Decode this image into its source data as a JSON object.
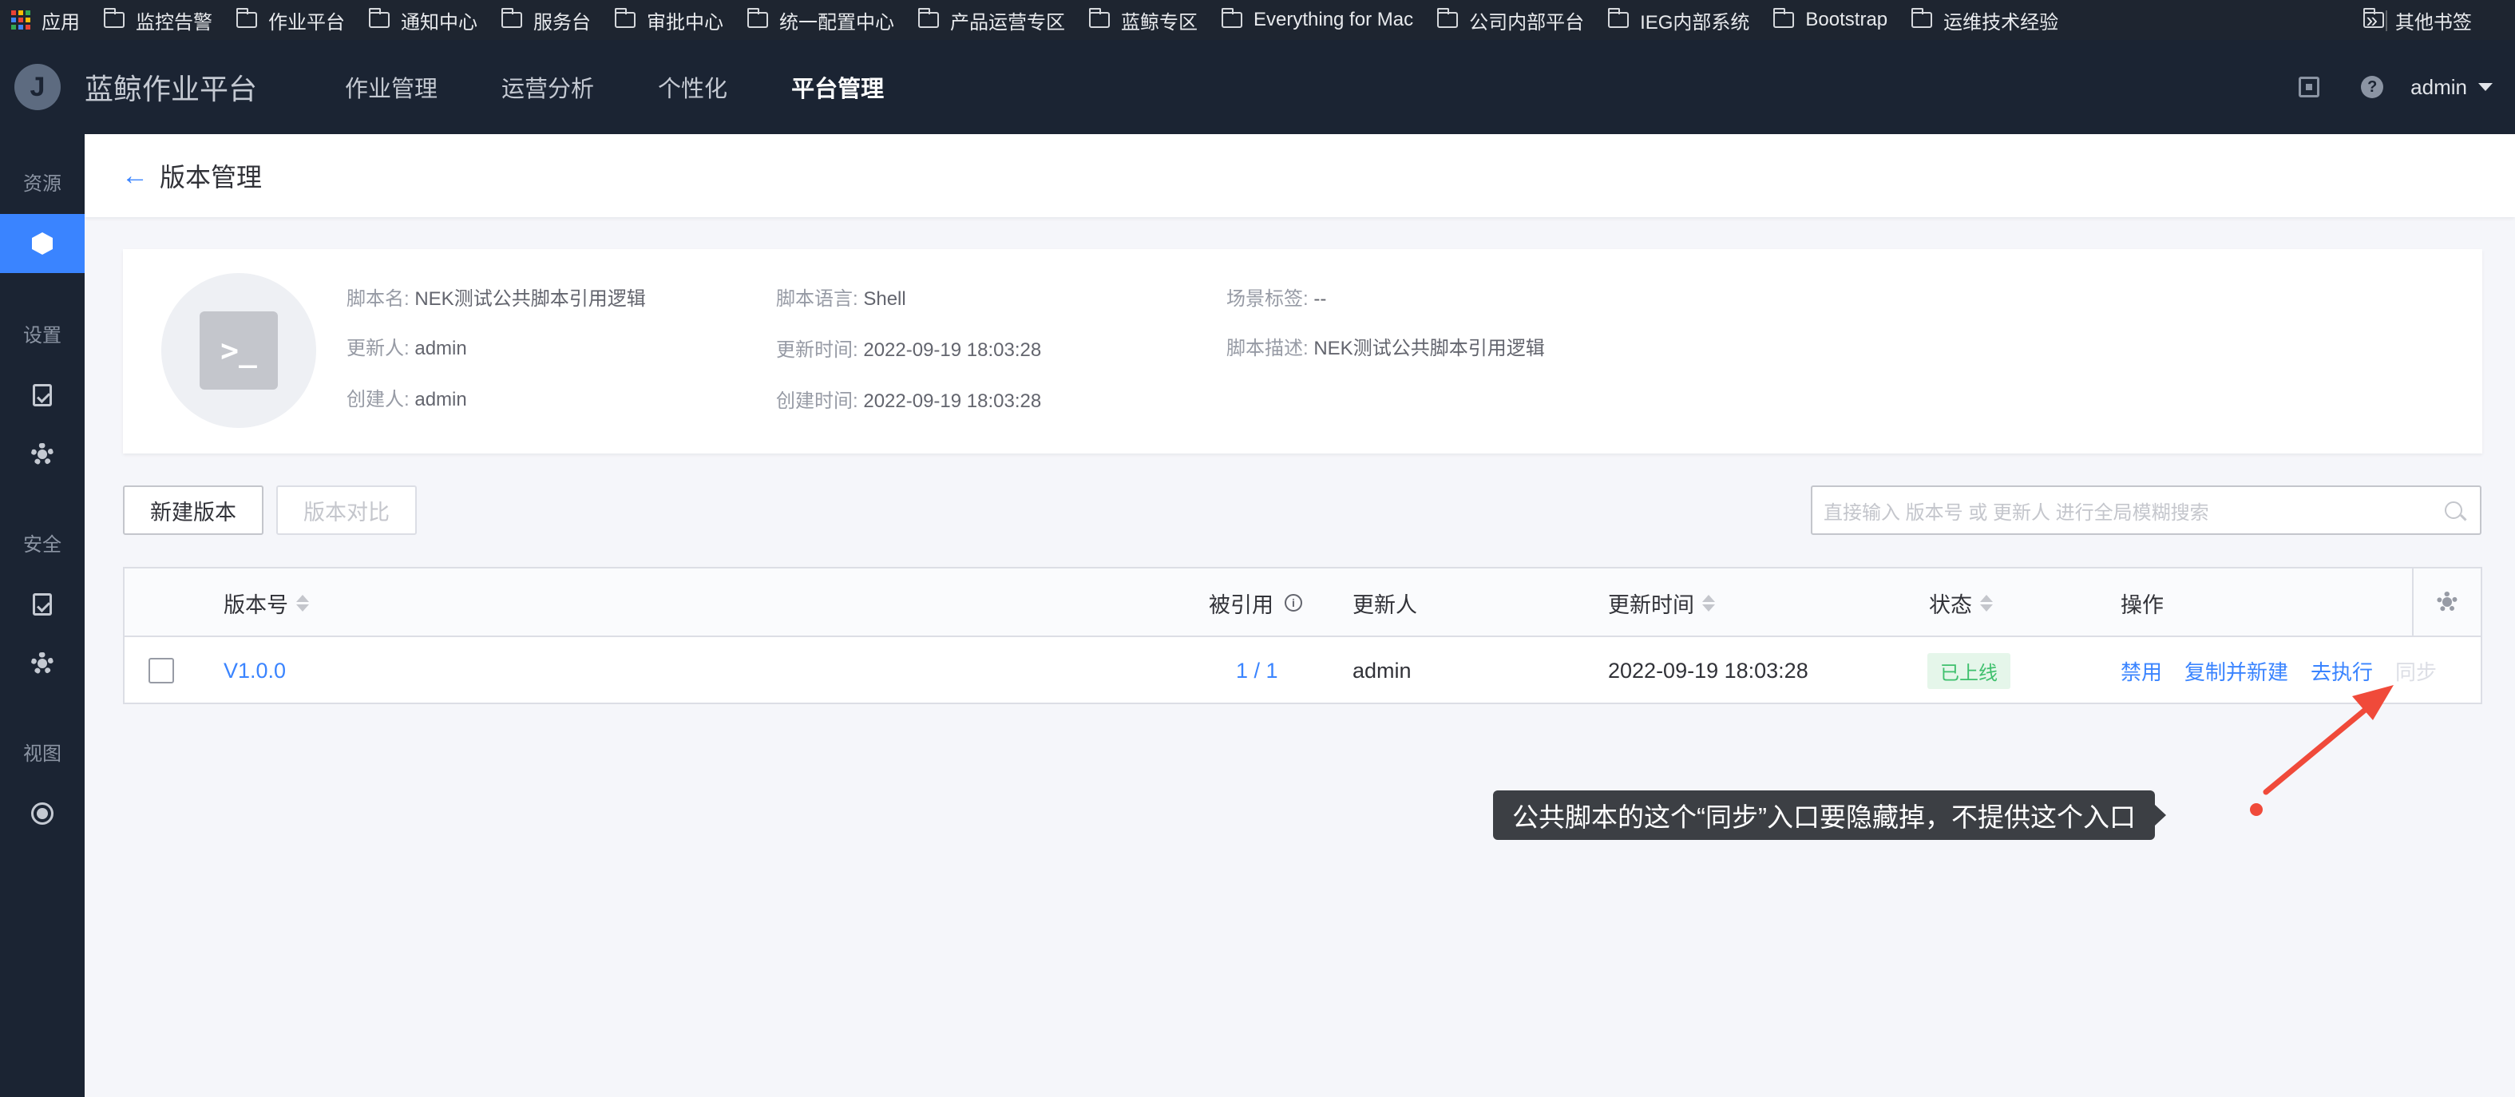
{
  "bookmarks": {
    "apps_label": "应用",
    "items": [
      "监控告警",
      "作业平台",
      "通知中心",
      "服务台",
      "审批中心",
      "统一配置中心",
      "产品运营专区",
      "蓝鲸专区",
      "Everything for Mac",
      "公司内部平台",
      "IEG内部系统",
      "Bootstrap",
      "运维技术经验"
    ],
    "more": "»",
    "other": "其他书签"
  },
  "topnav": {
    "logo_letter": "J",
    "brand": "蓝鲸作业平台",
    "items": [
      "作业管理",
      "运营分析",
      "个性化",
      "平台管理"
    ],
    "active_index": 3,
    "help_glyph": "?",
    "user": "admin"
  },
  "sidebar": {
    "groups": [
      "资源",
      "设置",
      "安全",
      "视图"
    ]
  },
  "page": {
    "back_glyph": "←",
    "title": "版本管理"
  },
  "script_info": {
    "name_label": "脚本名:",
    "name": "NEK测试公共脚本引用逻辑",
    "updater_label": "更新人:",
    "updater": "admin",
    "creator_label": "创建人:",
    "creator": "admin",
    "lang_label": "脚本语言:",
    "lang": "Shell",
    "update_time_label": "更新时间:",
    "update_time": "2022-09-19 18:03:28",
    "create_time_label": "创建时间:",
    "create_time": "2022-09-19 18:03:28",
    "tags_label": "场景标签:",
    "tags": "--",
    "desc_label": "脚本描述:",
    "desc": "NEK测试公共脚本引用逻辑",
    "terminal_glyph": ">_"
  },
  "toolbar": {
    "new_version": "新建版本",
    "compare": "版本对比",
    "search_placeholder": "直接输入 版本号 或 更新人 进行全局模糊搜索"
  },
  "table": {
    "headers": {
      "version": "版本号",
      "refs": "被引用",
      "updater": "更新人",
      "update_time": "更新时间",
      "status": "状态",
      "actions": "操作"
    },
    "info_glyph": "i",
    "rows": [
      {
        "version": "V1.0.0",
        "refs": "1 / 1",
        "updater": "admin",
        "update_time": "2022-09-19 18:03:28",
        "status": "已上线",
        "actions": [
          "禁用",
          "复制并新建",
          "去执行",
          "同步"
        ]
      }
    ]
  },
  "annotation": {
    "text": "公共脚本的这个“同步”入口要隐藏掉，不提供这个入口",
    "color": "#f04a3a"
  },
  "colors": {
    "primary": "#3a84ff",
    "nav_bg": "#1b2433",
    "success_bg": "#e5f6ea",
    "success_text": "#3fc06d"
  }
}
